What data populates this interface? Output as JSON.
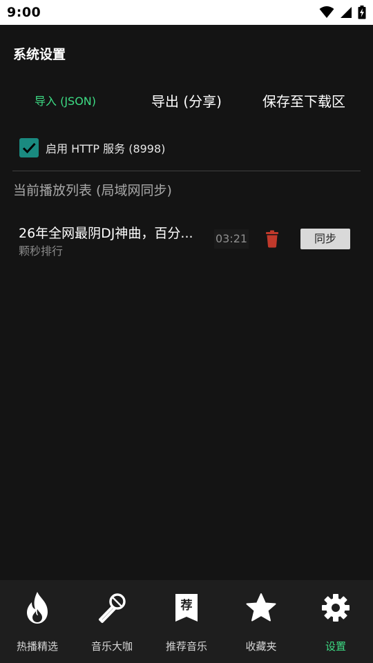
{
  "status_bar": {
    "time": "9:00"
  },
  "page": {
    "title": "系统设置"
  },
  "actions": {
    "import_label": "导入 (JSON)",
    "export_label": "导出 (分享)",
    "save_label": "保存至下载区"
  },
  "http_service": {
    "label": "启用 HTTP 服务 (8998)",
    "checked": true
  },
  "playlist": {
    "title": "当前播放列表 (局域网同步)",
    "items": [
      {
        "title": "26年全网最阴DJ神曲，百分...",
        "artist": "颗秒排行",
        "duration": "03:21",
        "sync_label": "同步"
      }
    ]
  },
  "bottom_nav": {
    "items": [
      {
        "label": "热播精选",
        "icon": "fire-icon"
      },
      {
        "label": "音乐大咖",
        "icon": "microphone-icon"
      },
      {
        "label": "推荐音乐",
        "icon": "bookmark-icon",
        "glyph": "荐"
      },
      {
        "label": "收藏夹",
        "icon": "star-icon"
      },
      {
        "label": "设置",
        "icon": "gear-icon",
        "active": true
      }
    ]
  },
  "colors": {
    "accent": "#3ddc84",
    "checkbox": "#1a8a80",
    "delete": "#c0392b",
    "background": "#141414",
    "nav_background": "#1e1e1e"
  }
}
